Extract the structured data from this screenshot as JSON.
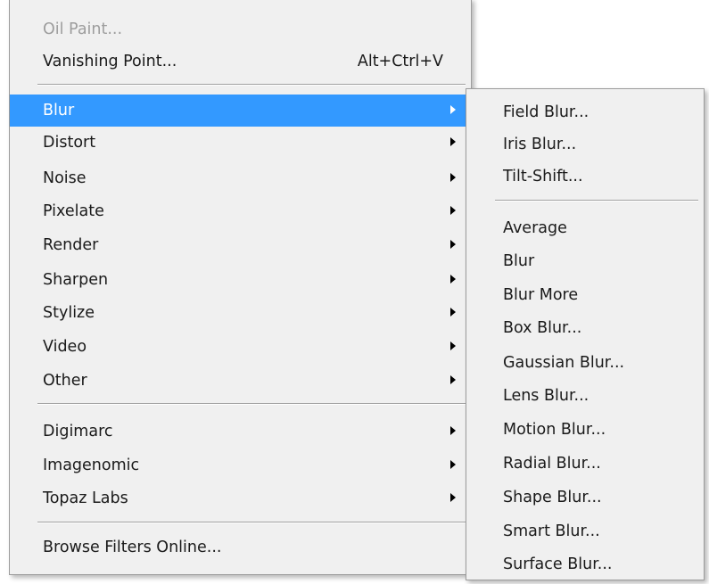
{
  "main_menu": {
    "top_items": [
      {
        "label": "Oil Paint...",
        "disabled": true
      },
      {
        "label": "Vanishing Point...",
        "shortcut": "Alt+Ctrl+V"
      }
    ],
    "filter_groups": [
      {
        "label": "Blur",
        "has_submenu": true,
        "highlighted": true
      },
      {
        "label": "Distort",
        "has_submenu": true
      },
      {
        "label": "Noise",
        "has_submenu": true
      },
      {
        "label": "Pixelate",
        "has_submenu": true
      },
      {
        "label": "Render",
        "has_submenu": true
      },
      {
        "label": "Sharpen",
        "has_submenu": true
      },
      {
        "label": "Stylize",
        "has_submenu": true
      },
      {
        "label": "Video",
        "has_submenu": true
      },
      {
        "label": "Other",
        "has_submenu": true
      }
    ],
    "plugins": [
      {
        "label": "Digimarc",
        "has_submenu": true
      },
      {
        "label": "Imagenomic",
        "has_submenu": true
      },
      {
        "label": "Topaz Labs",
        "has_submenu": true
      }
    ],
    "bottom_items": [
      {
        "label": "Browse Filters Online..."
      }
    ]
  },
  "blur_submenu": {
    "gallery": [
      {
        "label": "Field Blur..."
      },
      {
        "label": "Iris Blur..."
      },
      {
        "label": "Tilt-Shift..."
      }
    ],
    "filters": [
      {
        "label": "Average"
      },
      {
        "label": "Blur"
      },
      {
        "label": "Blur More"
      },
      {
        "label": "Box Blur..."
      },
      {
        "label": "Gaussian Blur..."
      },
      {
        "label": "Lens Blur..."
      },
      {
        "label": "Motion Blur..."
      },
      {
        "label": "Radial Blur..."
      },
      {
        "label": "Shape Blur..."
      },
      {
        "label": "Smart Blur..."
      },
      {
        "label": "Surface Blur..."
      }
    ]
  },
  "colors": {
    "menu_bg": "#f0f0f0",
    "highlight_bg": "#3399ff",
    "highlight_text": "#ffffff",
    "disabled_text": "#9d9d9d"
  }
}
